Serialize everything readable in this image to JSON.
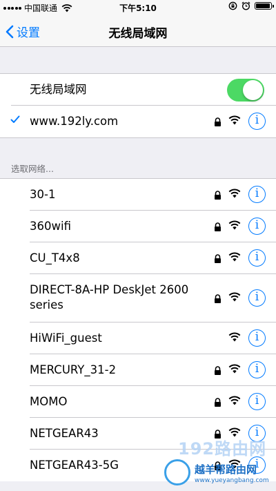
{
  "status_bar": {
    "carrier": "中国联通",
    "time": "下午5:10",
    "battery_level": 0.95
  },
  "nav": {
    "back_label": "设置",
    "title": "无线局域网"
  },
  "wifi_toggle": {
    "label": "无线局域网",
    "on": true,
    "color": "#4cd964"
  },
  "connected": {
    "name": "www.192ly.com",
    "locked": true,
    "info": "i"
  },
  "section_header": "选取网络...",
  "networks": [
    {
      "name": "30-1",
      "locked": true,
      "info": "i"
    },
    {
      "name": "360wifi",
      "locked": true,
      "info": "i"
    },
    {
      "name": "CU_T4x8",
      "locked": true,
      "info": "i"
    },
    {
      "name": "DIRECT-8A-HP DeskJet 2600 series",
      "locked": true,
      "info": "i"
    },
    {
      "name": "HiWiFi_guest",
      "locked": false,
      "info": "i"
    },
    {
      "name": "MERCURY_31-2",
      "locked": true,
      "info": "i"
    },
    {
      "name": "MOMO",
      "locked": true,
      "info": "i"
    },
    {
      "name": "NETGEAR43",
      "locked": true,
      "info": "i"
    },
    {
      "name": "NETGEAR43-5G",
      "locked": true,
      "info": "i"
    }
  ],
  "watermark": {
    "text": "192路由网",
    "logo_name": "越羊帮路由网",
    "logo_url": "www.yueyangbang.com"
  },
  "colors": {
    "accent": "#007aff",
    "toggle_on": "#4cd964",
    "background": "#efeff4"
  }
}
